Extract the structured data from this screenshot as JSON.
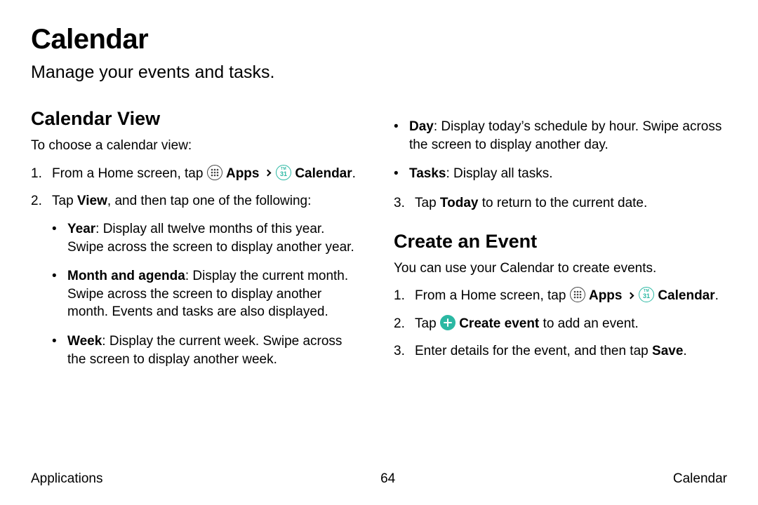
{
  "title": "Calendar",
  "subtitle": "Manage your events and tasks.",
  "section1": {
    "heading": "Calendar View",
    "intro": "To choose a calendar view:",
    "step1_a": "From a Home screen, tap ",
    "step1_apps": "Apps",
    "step1_cal": "Calendar",
    "step1_period": ".",
    "step2_a": "Tap ",
    "step2_view": "View",
    "step2_b": ", and then tap one of the following:",
    "bullets": {
      "year_label": "Year",
      "year_text": ": Display all twelve months of this year. Swipe across the screen to display another year.",
      "month_label": "Month and agenda",
      "month_text": ": Display the current month. Swipe across the screen to display another month. Events and tasks are also displayed.",
      "week_label": "Week",
      "week_text": ": Display the current week. Swipe across the screen to display another week.",
      "day_label": "Day",
      "day_text": ": Display today’s schedule by hour. Swipe across the screen to display another day.",
      "tasks_label": "Tasks",
      "tasks_text": ": Display all tasks."
    },
    "step3_a": "Tap ",
    "step3_today": "Today",
    "step3_b": " to return to the current date."
  },
  "section2": {
    "heading": "Create an Event",
    "intro": "You can use your Calendar to create events.",
    "step1_a": "From a Home screen, tap ",
    "step1_apps": "Apps",
    "step1_cal": "Calendar",
    "step1_period": ".",
    "step2_a": "Tap ",
    "step2_create": "Create event",
    "step2_b": " to add an event.",
    "step3_a": "Enter details for the event, and then tap ",
    "step3_save": "Save",
    "step3_b": "."
  },
  "footer": {
    "left": "Applications",
    "center": "64",
    "right": "Calendar"
  },
  "icons": {
    "calendar_day": "31",
    "calendar_tm": "TM"
  }
}
